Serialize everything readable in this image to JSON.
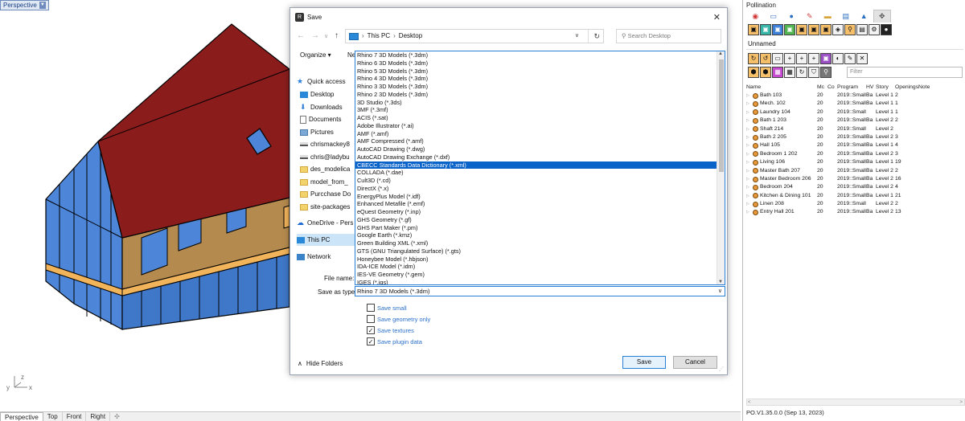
{
  "viewport": {
    "label": "Perspective",
    "axes": {
      "x": "x",
      "y": "y",
      "z": "z"
    }
  },
  "view_tabs": [
    "Perspective",
    "Top",
    "Front",
    "Right"
  ],
  "dialog": {
    "title": "Save",
    "breadcrumb": [
      "This PC",
      "Desktop"
    ],
    "search_placeholder": "Search Desktop",
    "organize_label": "Organize ▾",
    "newfolder_label": "Ne",
    "nav_items": [
      {
        "label": "Quick access",
        "icon": "star-icon"
      },
      {
        "label": "Desktop",
        "icon": "desktop-icon"
      },
      {
        "label": "Downloads",
        "icon": "download-icon"
      },
      {
        "label": "Documents",
        "icon": "document-icon"
      },
      {
        "label": "Pictures",
        "icon": "pictures-icon"
      },
      {
        "label": "chrismackey8",
        "icon": "drive-icon"
      },
      {
        "label": "chris@ladybu",
        "icon": "drive-icon"
      },
      {
        "label": "des_modelica",
        "icon": "folder-icon"
      },
      {
        "label": "model_from_",
        "icon": "folder-icon"
      },
      {
        "label": "Purcchase Do",
        "icon": "folder-icon"
      },
      {
        "label": "site-packages",
        "icon": "folder-icon"
      },
      {
        "label": "OneDrive - Pers",
        "icon": "cloud-icon"
      },
      {
        "label": "This PC",
        "icon": "pc-icon"
      },
      {
        "label": "Network",
        "icon": "network-icon"
      }
    ],
    "file_types": [
      "Rhino 7 3D Models (*.3dm)",
      "Rhino 6 3D Models (*.3dm)",
      "Rhino 5 3D Models (*.3dm)",
      "Rhino 4 3D Models (*.3dm)",
      "Rhino 3 3D Models (*.3dm)",
      "Rhino 2 3D Models (*.3dm)",
      "3D Studio (*.3ds)",
      "3MF (*.3mf)",
      "ACIS (*.sat)",
      "Adobe Illustrator (*.ai)",
      "AMF (*.amf)",
      "AMF Compressed (*.amf)",
      "AutoCAD Drawing (*.dwg)",
      "AutoCAD Drawing Exchange (*.dxf)",
      "CBECC Standards Data Dictionary (*.xml)",
      "COLLADA (*.dae)",
      "Cult3D (*.cd)",
      "DirectX (*.x)",
      "EnergyPlus Model (*.idf)",
      "Enhanced Metafile (*.emf)",
      "eQuest Geometry (*.inp)",
      "GHS Geometry (*.gf)",
      "GHS Part Maker (*.pm)",
      "Google Earth (*.kmz)",
      "Green Building XML (*.xml)",
      "GTS (GNU Triangulated Surface) (*.gts)",
      "Honeybee Model (*.hbjson)",
      "IDA-ICE Model (*.idm)",
      "IES-VE Geometry (*.gem)",
      "IGES (*.igs)"
    ],
    "highlighted_type": "CBECC Standards Data Dictionary (*.xml)",
    "file_name_label": "File name:",
    "save_as_type_label": "Save as type:",
    "save_as_type_value": "Rhino 7 3D Models (*.3dm)",
    "options": [
      {
        "label": "Save small",
        "checked": false
      },
      {
        "label": "Save geometry only",
        "checked": false
      },
      {
        "label": "Save textures",
        "checked": true
      },
      {
        "label": "Save plugin data",
        "checked": true
      }
    ],
    "hide_folders_label": "Hide Folders",
    "save_label": "Save",
    "cancel_label": "Cancel"
  },
  "panel": {
    "title": "Pollination",
    "model_name": "Unnamed",
    "filter_placeholder": "Filter",
    "columns": [
      "Name",
      "Mc",
      "Co",
      "Program",
      "HV",
      "Story",
      "Openings",
      "Notes"
    ],
    "rooms": [
      {
        "name": "Bath 103",
        "mc": "20",
        "program": "2019::SmallOffice::B",
        "hv": "Ba",
        "story": "Level 1",
        "openings": "2"
      },
      {
        "name": "Mech. 102",
        "mc": "20",
        "program": "2019::SmallOffice::E",
        "hv": "Ba",
        "story": "Level 1",
        "openings": "1"
      },
      {
        "name": "Laundry 104",
        "mc": "20",
        "program": "2019::SmallOffice::S",
        "hv": "",
        "story": "Level 1",
        "openings": "1"
      },
      {
        "name": "Bath 1 203",
        "mc": "20",
        "program": "2019::SmallOffice::F",
        "hv": "Ba",
        "story": "Level 2",
        "openings": "2"
      },
      {
        "name": "Shaft 214",
        "mc": "20",
        "program": "2019::SmallOffice::S",
        "hv": "",
        "story": "Level 2",
        "openings": ""
      },
      {
        "name": "Bath 2 205",
        "mc": "20",
        "program": "2019::SmallOffice::F",
        "hv": "Ba",
        "story": "Level 2",
        "openings": "3"
      },
      {
        "name": "Hall 105",
        "mc": "20",
        "program": "2019::SmallOffice::C",
        "hv": "Ba",
        "story": "Level 1",
        "openings": "4"
      },
      {
        "name": "Bedroom 1 202",
        "mc": "20",
        "program": "2019::SmallOffice::C",
        "hv": "Ba",
        "story": "Level 2",
        "openings": "3"
      },
      {
        "name": "Living 106",
        "mc": "20",
        "program": "2019::SmallOffice::C",
        "hv": "Ba",
        "story": "Level 1",
        "openings": "19"
      },
      {
        "name": "Master Bath 207",
        "mc": "20",
        "program": "2019::SmallOffice::F",
        "hv": "Ba",
        "story": "Level 2",
        "openings": "2"
      },
      {
        "name": "Master Bedroom 206",
        "mc": "20",
        "program": "2019::SmallOffice::C",
        "hv": "Ba",
        "story": "Level 2",
        "openings": "16"
      },
      {
        "name": "Bedroom 204",
        "mc": "20",
        "program": "2019::SmallOffice::C",
        "hv": "Ba",
        "story": "Level 2",
        "openings": "4"
      },
      {
        "name": "Kitchen & Dining 101",
        "mc": "20",
        "program": "2019::SmallOffice::C",
        "hv": "Ba",
        "story": "Level 1",
        "openings": "21"
      },
      {
        "name": "Linen 208",
        "mc": "20",
        "program": "2019::SmallOffice::S",
        "hv": "",
        "story": "Level 2",
        "openings": "2"
      },
      {
        "name": "Entry Hall 201",
        "mc": "20",
        "program": "2019::SmallOffice::C",
        "hv": "Ba",
        "story": "Level 2",
        "openings": "13"
      }
    ],
    "status": "PO.V1.35.0.0 (Sep 13, 2023)"
  },
  "colors": {
    "roof": "#8b1c1c",
    "wall": "#b58a4e",
    "glass": "#4d86d8",
    "highlight": "#0a63c9"
  }
}
